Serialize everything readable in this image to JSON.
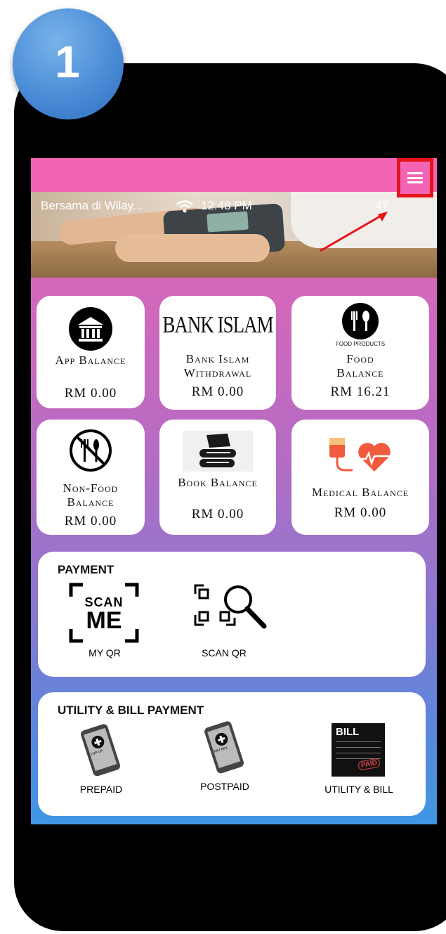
{
  "step_badge": "1",
  "status_bar": {
    "carrier": "Bersama di Wilay...",
    "time": "12:48 PM",
    "battery": "47"
  },
  "balances": [
    {
      "label": "App Balance",
      "amount": "RM 0.00",
      "icon": "bank-building-icon"
    },
    {
      "label": "Bank Islam Withdrawal",
      "amount": "RM 0.00",
      "icon": "bank-islam-logo",
      "logo_text": "BANK ISLAM"
    },
    {
      "label": "Food Balance",
      "amount": "RM 16.21",
      "icon": "food-products-icon",
      "icon_caption": "FOOD PRODUCTS"
    },
    {
      "label": "Non-Food Balance",
      "amount": "RM 0.00",
      "icon": "no-food-icon"
    },
    {
      "label": "Book Balance",
      "amount": "RM 0.00",
      "icon": "books-icon"
    },
    {
      "label": "Medical Balance",
      "amount": "RM 0.00",
      "icon": "medical-heart-icon"
    }
  ],
  "payment": {
    "title": "PAYMENT",
    "items": [
      {
        "label": "MY QR",
        "icon": "scan-me-icon",
        "icon_text_1": "SCAN",
        "icon_text_2": "ME"
      },
      {
        "label": "SCAN QR",
        "icon": "qr-search-icon"
      }
    ]
  },
  "utility": {
    "title": "UTILITY & BILL PAYMENT",
    "items": [
      {
        "label": "PREPAID",
        "icon": "prepaid-phone-icon",
        "icon_text": "TOP UP"
      },
      {
        "label": "POSTPAID",
        "icon": "postpaid-phone-icon",
        "icon_text": "PAY BILL"
      },
      {
        "label": "UTILITY & BILL",
        "icon": "bill-icon",
        "icon_text": "BILL",
        "stamp_text": "PAID"
      }
    ]
  },
  "colors": {
    "header_pink": "#f365b4",
    "gradient_bottom": "#3f97e5",
    "highlight_red": "#e4141b",
    "badge_blue": "#4a8cd6"
  }
}
